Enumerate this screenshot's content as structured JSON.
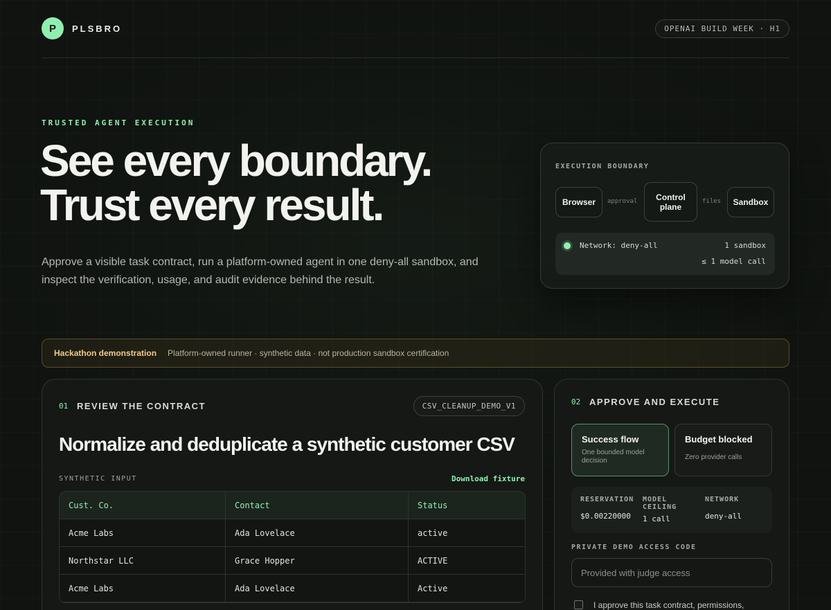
{
  "header": {
    "logo_letter": "P",
    "brand": "PLSBRO",
    "event_badge": "OPENAI BUILD WEEK · H1"
  },
  "hero": {
    "eyebrow": "TRUSTED AGENT EXECUTION",
    "headline_line1": "See every boundary.",
    "headline_line2": "Trust every result.",
    "lede": "Approve a visible task contract, run a platform-owned agent in one deny-all sandbox, and inspect the verification, usage, and audit evidence behind the result."
  },
  "boundary": {
    "title": "EXECUTION BOUNDARY",
    "node_browser": "Browser",
    "edge_approval": "approval",
    "node_control": "Control plane",
    "edge_files": "files",
    "node_sandbox": "Sandbox",
    "network_label": "Network: deny-all",
    "sandbox_count": "1 sandbox",
    "model_calls": "≤ 1 model call"
  },
  "banner": {
    "title": "Hackathon demonstration",
    "text": "Platform-owned runner · synthetic data · not production sandbox certification"
  },
  "contract": {
    "step_number": "01",
    "step_title": "REVIEW THE CONTRACT",
    "contract_id": "CSV_CLEANUP_DEMO_V1",
    "task_title": "Normalize and deduplicate a synthetic customer CSV",
    "input_label": "SYNTHETIC INPUT",
    "download_label": "Download fixture",
    "table": {
      "columns": [
        "Cust. Co.",
        "Contact",
        "Status"
      ],
      "rows": [
        [
          "Acme Labs",
          "Ada Lovelace",
          "active"
        ],
        [
          "Northstar LLC",
          "Grace Hopper",
          "ACTIVE"
        ],
        [
          "Acme Labs",
          "Ada Lovelace",
          "Active"
        ]
      ]
    }
  },
  "approve": {
    "step_number": "02",
    "step_title": "APPROVE AND EXECUTE",
    "flows": [
      {
        "title": "Success flow",
        "subtitle": "One bounded model decision",
        "selected": true
      },
      {
        "title": "Budget blocked",
        "subtitle": "Zero provider calls",
        "selected": false
      }
    ],
    "stats": {
      "reservation_label": "RESERVATION",
      "reservation_value": "$0.00220000",
      "model_ceiling_label": "MODEL CEILING",
      "model_ceiling_value": "1 call",
      "network_label": "NETWORK",
      "network_value": "deny-all"
    },
    "access_code_label": "PRIVATE DEMO ACCESS CODE",
    "access_code_placeholder": "Provided with judge access",
    "access_code_value": "",
    "approve_text": "I approve this task contract, permissions,",
    "approve_checked": false
  },
  "colors": {
    "accent": "#8ef0b0",
    "background": "#101310",
    "banner_text": "#f2c98a"
  }
}
